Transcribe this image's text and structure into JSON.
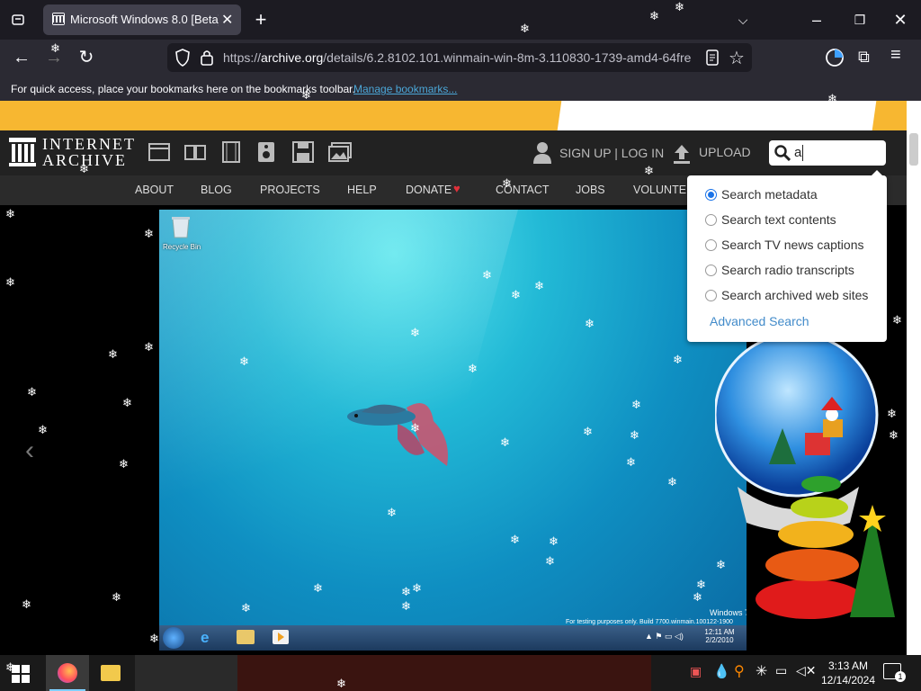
{
  "browser": {
    "tab_title": "Microsoft Windows 8.0 [Beta] ...",
    "url_prefix": "https://",
    "url_domain": "archive.org",
    "url_rest": "/details/6.2.8102.101.winmain-win-8m-3.110830-1739-amd4-64fre",
    "bookmarks_text": "For quick access, place your bookmarks here on the bookmarks toolbar.",
    "bookmarks_link": "Manage bookmarks..."
  },
  "archive": {
    "logo_line1": "INTERNET",
    "logo_line2": "ARCHIVE",
    "auth": "SIGN UP | LOG IN",
    "upload": "UPLOAD",
    "search_value": "a",
    "nav": [
      "ABOUT",
      "BLOG",
      "PROJECTS",
      "HELP",
      "DONATE",
      "CONTACT",
      "JOBS",
      "VOLUNTEER"
    ],
    "search_options": [
      "Search metadata",
      "Search text contents",
      "Search TV news captions",
      "Search radio transcripts",
      "Search archived web sites"
    ],
    "advanced_search": "Advanced Search"
  },
  "win7": {
    "recycle_bin": "Recycle Bin",
    "watermark_title": "Windows 7",
    "watermark_build": "For testing purposes only. Build 7700.winmain.100122-1900",
    "clock_time": "12:11 AM",
    "clock_date": "2/2/2010"
  },
  "taskbar": {
    "time": "3:13 AM",
    "date": "12/14/2024",
    "notification_count": "1"
  },
  "colors": {
    "accent_yellow": "#f7b731",
    "link_blue": "#4ba7d8",
    "donate_heart": "#e0303a"
  }
}
